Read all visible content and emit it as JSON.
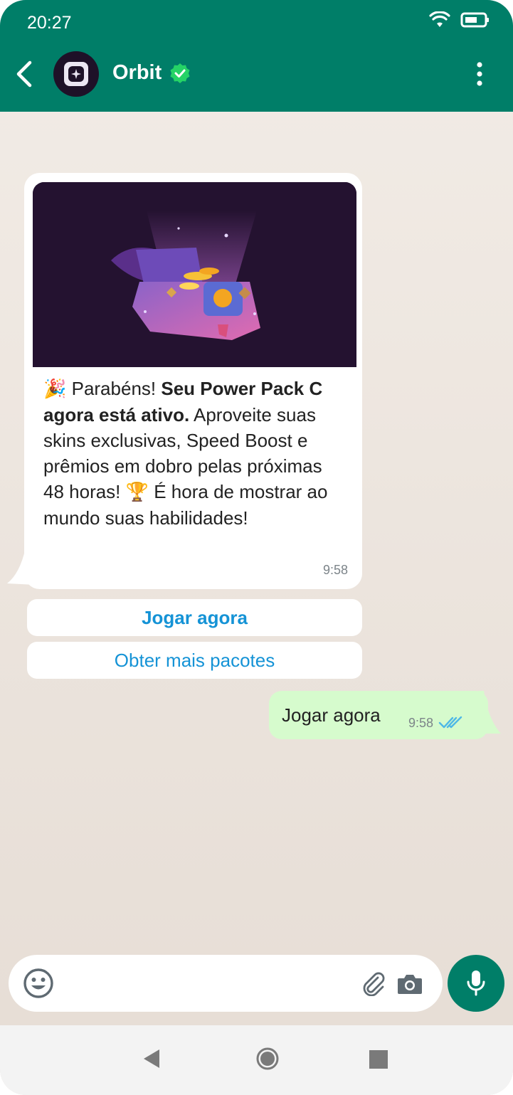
{
  "status_bar": {
    "time": "20:27",
    "wifi_icon": "wifi-icon",
    "battery_icon": "battery-icon"
  },
  "header": {
    "contact_name": "Orbit",
    "verified": true,
    "back_icon": "back-arrow-icon",
    "menu_icon": "more-vertical-icon"
  },
  "colors": {
    "header": "#007e68",
    "incoming_bubble": "#ffffff",
    "outgoing_bubble": "#d6fbcd",
    "link_blue": "#1593d6",
    "read_ticks": "#4fb8e6"
  },
  "incoming_message": {
    "emoji_party": "🎉",
    "text_1": " Parabéns! ",
    "text_bold": "Seu Power Pack C agora está ativo.",
    "text_2": " Aproveite suas skins exclusivas, Speed Boost e prêmios em dobro pelas próximas 48 horas! ",
    "emoji_trophy": "🏆",
    "text_3": " É hora de mostrar ao mundo suas habilidades!",
    "time": "9:58"
  },
  "quick_replies": [
    {
      "label": "Jogar agora"
    },
    {
      "label": "Obter mais pacotes"
    }
  ],
  "outgoing_message": {
    "text": "Jogar agora",
    "time": "9:58",
    "status": "read"
  },
  "composer": {
    "emoji_icon": "emoji-icon",
    "attach_icon": "paperclip-icon",
    "camera_icon": "camera-icon",
    "mic_icon": "microphone-icon"
  },
  "navigation": {
    "back": "nav-back-icon",
    "home": "nav-home-icon",
    "recents": "nav-recents-icon"
  }
}
